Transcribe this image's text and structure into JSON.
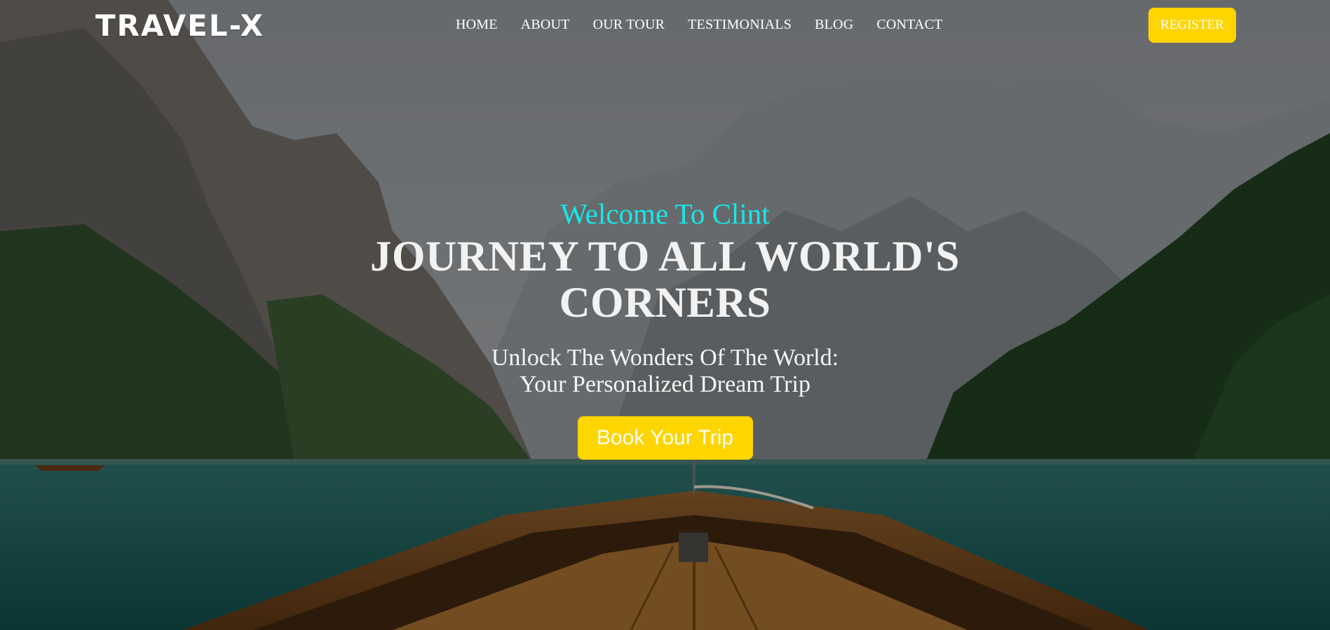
{
  "brand": {
    "logo_text": "TRAVEL-X"
  },
  "nav": {
    "items": [
      {
        "label": "HOME"
      },
      {
        "label": "ABOUT"
      },
      {
        "label": "OUR TOUR"
      },
      {
        "label": "TESTIMONIALS"
      },
      {
        "label": "BLOG"
      },
      {
        "label": "CONTACT"
      }
    ],
    "register_label": "REGISTER"
  },
  "hero": {
    "welcome": "Welcome To Clint",
    "headline_line1": "JOURNEY TO ALL WORLD'S",
    "headline_line2": "CORNERS",
    "subtitle_line1": "Unlock The Wonders Of The World:",
    "subtitle_line2": "Your Personalized Dream Trip",
    "cta_label": "Book Your Trip"
  },
  "colors": {
    "accent_yellow": "#ffd500",
    "welcome_cyan": "#16e8ea",
    "text_white": "#ffffff"
  }
}
